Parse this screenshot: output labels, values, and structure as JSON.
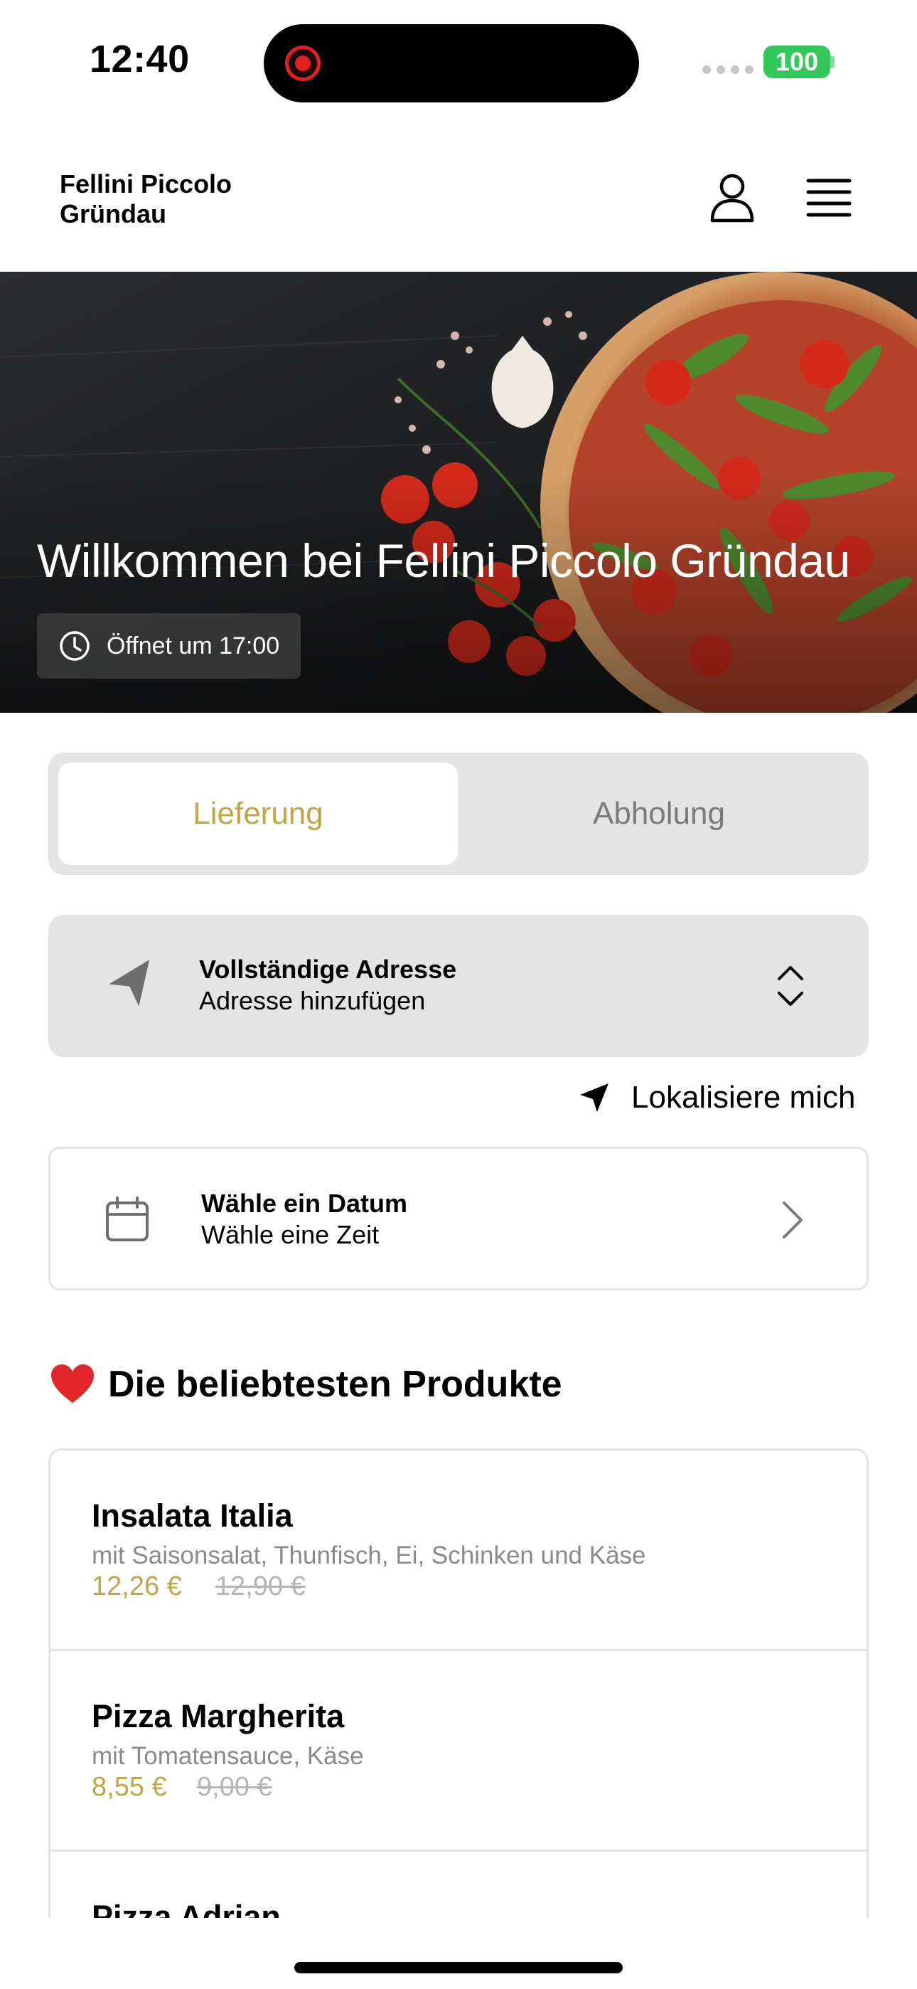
{
  "status_bar": {
    "time": "12:40",
    "battery": "100"
  },
  "header": {
    "brand_line1": "Fellini Piccolo",
    "brand_line2": "Gründau",
    "icons": [
      "user-icon",
      "menu-icon"
    ]
  },
  "hero": {
    "title": "Willkommen bei Fellini Piccolo Gründau",
    "opening": "Öffnet um 17:00"
  },
  "order_mode": {
    "tabs": [
      "Lieferung",
      "Abholung"
    ],
    "selected": "Lieferung"
  },
  "address": {
    "title": "Vollständige Adresse",
    "subtitle": "Adresse hinzufügen"
  },
  "locate_label": "Lokalisiere mich",
  "schedule": {
    "title": "Wähle ein Datum",
    "subtitle": "Wähle eine Zeit"
  },
  "popular": {
    "heading": "Die beliebtesten Produkte",
    "products": [
      {
        "name": "Insalata Italia",
        "description": "mit Saisonsalat, Thunfisch, Ei, Schinken und Käse",
        "price": "12,26 €",
        "old_price": "12,90 €"
      },
      {
        "name": "Pizza Margherita",
        "description": "mit Tomatensauce, Käse",
        "price": "8,55 €",
        "old_price": "9,00 €"
      },
      {
        "name": "Pizza Adrian"
      }
    ]
  },
  "colors": {
    "accent": "#c2a544",
    "card_gray": "#e4e4e4",
    "battery_green": "#34c759"
  }
}
